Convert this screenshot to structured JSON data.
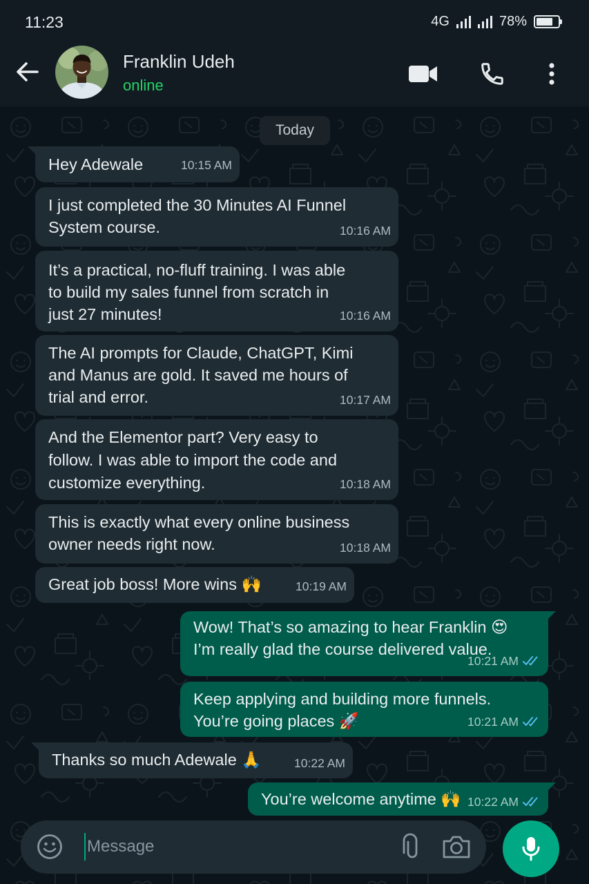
{
  "status_bar": {
    "time": "11:23",
    "network": "4G",
    "battery": "78%",
    "battery_level": 0.78
  },
  "header": {
    "name": "Franklin Udeh",
    "status": "online",
    "avatar_icon": "person-avatar",
    "icons": [
      "back-arrow-icon",
      "video-call-icon",
      "phone-icon",
      "more-vertical-icon"
    ]
  },
  "chat": {
    "date_label": "Today",
    "messages": [
      {
        "dir": "in",
        "text": "Hey Adewale",
        "time": "10:15 AM"
      },
      {
        "dir": "in",
        "text": "I just completed the 30 Minutes AI Funnel\nSystem course.",
        "time": "10:16 AM"
      },
      {
        "dir": "in",
        "text": "It’s a practical, no-fluff training. I was able\nto build my sales funnel from scratch in\njust 27 minutes!",
        "time": "10:16 AM"
      },
      {
        "dir": "in",
        "text": "The AI prompts for Claude, ChatGPT, Kimi\nand Manus are gold. It saved me hours of\ntrial and error.",
        "time": "10:17 AM"
      },
      {
        "dir": "in",
        "text": "And the Elementor part? Very easy to\nfollow. I was able to import the code and\ncustomize everything.",
        "time": "10:18 AM"
      },
      {
        "dir": "in",
        "text": "This is exactly what every online business\nowner needs right now.",
        "time": "10:18 AM"
      },
      {
        "dir": "in",
        "text": "Great job boss! More wins 🙌",
        "time": "10:19 AM"
      },
      {
        "dir": "out",
        "text": "Wow! That’s so amazing to hear Franklin 😍\nI’m really glad the course delivered value.",
        "time": "10:21 AM",
        "read": true
      },
      {
        "dir": "out",
        "text": "Keep applying and building more funnels.\nYou’re going places 🚀",
        "time": "10:21 AM",
        "read": true
      },
      {
        "dir": "in",
        "text": "Thanks so much Adewale 🙏",
        "time": "10:22 AM"
      },
      {
        "dir": "out",
        "text": "You’re welcome anytime 🙌",
        "time": "10:22 AM",
        "read": true
      }
    ]
  },
  "composer": {
    "placeholder": "Message",
    "icons": [
      "emoji-icon",
      "attach-icon",
      "camera-icon",
      "mic-icon"
    ]
  },
  "colors": {
    "background": "#0b141a",
    "bar": "#121b22",
    "incoming_bubble": "#1f2c33",
    "outgoing_bubble": "#005c4b",
    "accent": "#00a884",
    "online": "#25d366",
    "read_ticks": "#53bdeb"
  }
}
